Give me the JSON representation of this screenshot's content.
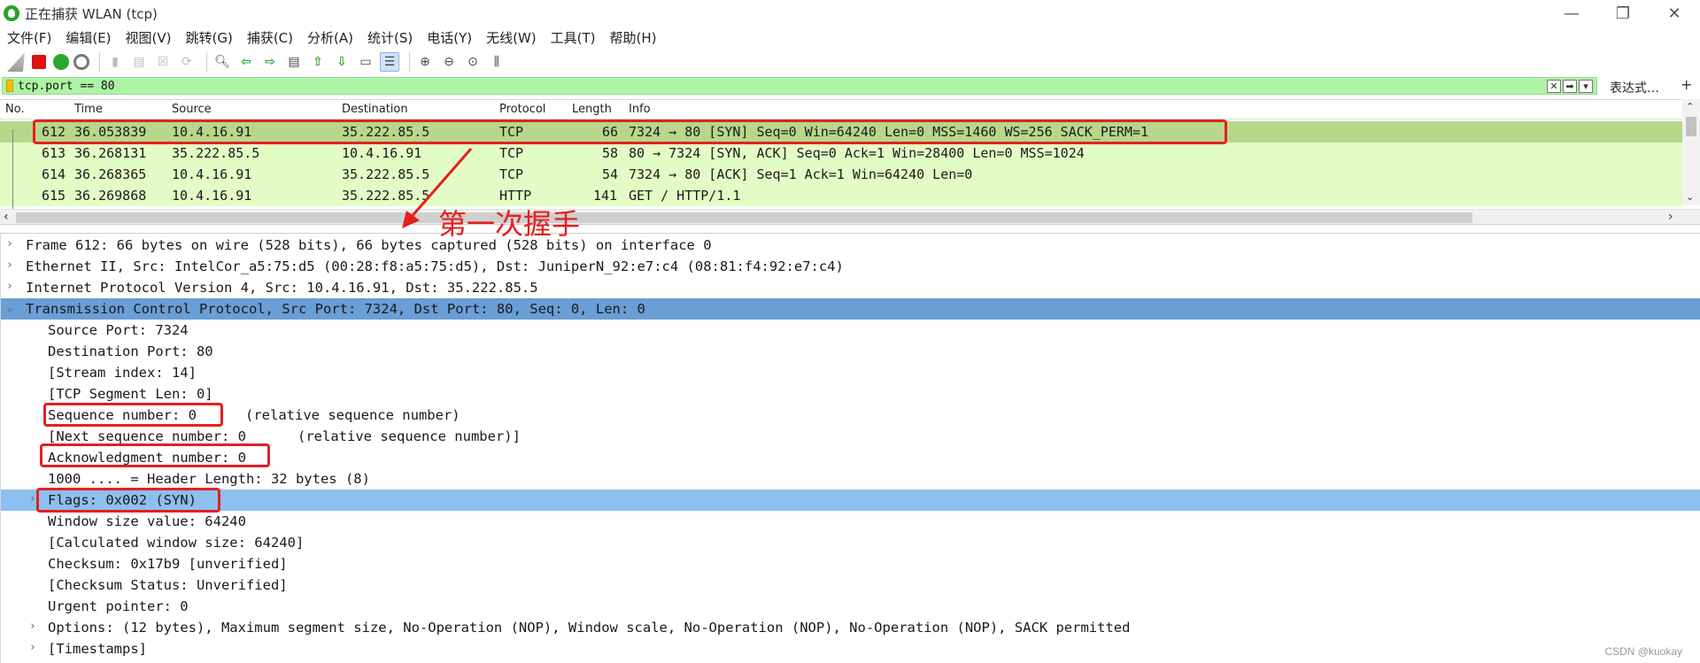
{
  "window": {
    "title": "正在捕获 WLAN (tcp)",
    "controls": [
      "—",
      "❐",
      "✕"
    ]
  },
  "menu": [
    "文件(F)",
    "编辑(E)",
    "视图(V)",
    "跳转(G)",
    "捕获(C)",
    "分析(A)",
    "统计(S)",
    "电话(Y)",
    "无线(W)",
    "工具(T)",
    "帮助(H)"
  ],
  "toolbar": {
    "icons": [
      "shark-fin-icon",
      "stop-capture-icon",
      "restart-capture-icon",
      "capture-options-icon",
      "open-file-icon",
      "save-file-icon",
      "close-file-icon",
      "reload-icon",
      "find-icon",
      "go-back-icon",
      "go-forward-icon",
      "go-to-packet-icon",
      "first-packet-icon",
      "last-packet-icon",
      "auto-scroll-icon",
      "colorize-icon",
      "zoom-in-icon",
      "zoom-out-icon",
      "normal-size-icon",
      "resize-columns-icon"
    ]
  },
  "filter": {
    "value": "tcp.port == 80",
    "expression_label": "表达式…",
    "plus_label": "+"
  },
  "packet_list": {
    "headers": {
      "no": "No.",
      "time": "Time",
      "source": "Source",
      "destination": "Destination",
      "protocol": "Protocol",
      "length": "Length",
      "info": "Info"
    },
    "rows": [
      {
        "no": "612",
        "time": "36.053839",
        "source": "10.4.16.91",
        "destination": "35.222.85.5",
        "protocol": "TCP",
        "length": "66",
        "info": "7324 → 80 [SYN] Seq=0 Win=64240 Len=0 MSS=1460 WS=256 SACK_PERM=1"
      },
      {
        "no": "613",
        "time": "36.268131",
        "source": "35.222.85.5",
        "destination": "10.4.16.91",
        "protocol": "TCP",
        "length": "58",
        "info": "80 → 7324 [SYN, ACK] Seq=0 Ack=1 Win=28400 Len=0 MSS=1024"
      },
      {
        "no": "614",
        "time": "36.268365",
        "source": "10.4.16.91",
        "destination": "35.222.85.5",
        "protocol": "TCP",
        "length": "54",
        "info": "7324 → 80 [ACK] Seq=1 Ack=1 Win=64240 Len=0"
      },
      {
        "no": "615",
        "time": "36.269868",
        "source": "10.4.16.91",
        "destination": "35.222.85.5",
        "protocol": "HTTP",
        "length": "141",
        "info": "GET / HTTP/1.1"
      }
    ]
  },
  "details": {
    "frame": "Frame 612: 66 bytes on wire (528 bits), 66 bytes captured (528 bits) on interface 0",
    "ethernet": "Ethernet II, Src: IntelCor_a5:75:d5 (00:28:f8:a5:75:d5), Dst: JuniperN_92:e7:c4 (08:81:f4:92:e7:c4)",
    "ip": "Internet Protocol Version 4, Src: 10.4.16.91, Dst: 35.222.85.5",
    "tcp": "Transmission Control Protocol, Src Port: 7324, Dst Port: 80, Seq: 0, Len: 0",
    "tcp_fields": {
      "src_port": "Source Port: 7324",
      "dst_port": "Destination Port: 80",
      "stream_index": "[Stream index: 14]",
      "segment_len": "[TCP Segment Len: 0]",
      "seq": "Sequence number: 0",
      "seq_note": "(relative sequence number)",
      "next_seq": "[Next sequence number: 0",
      "next_seq_note": "(relative sequence number)]",
      "ack": "Acknowledgment number: 0",
      "header_len": "1000 .... = Header Length: 32 bytes (8)",
      "flags": "Flags: 0x002 (SYN)",
      "window": "Window size value: 64240",
      "calc_window": "[Calculated window size: 64240]",
      "checksum": "Checksum: 0x17b9 [unverified]",
      "checksum_status": "[Checksum Status: Unverified]",
      "urgent": "Urgent pointer: 0",
      "options": "Options: (12 bytes), Maximum segment size, No-Operation (NOP), Window scale, No-Operation (NOP), No-Operation (NOP), SACK permitted",
      "timestamps": "[Timestamps]"
    }
  },
  "annotation": {
    "label": "第一次握手",
    "color": "#e61f1f"
  },
  "watermark": "CSDN @kuokay",
  "colors": {
    "filter_bg": "#aef4a5",
    "selected_packet": "#b7d88a",
    "tcp_packet": "#e3fcc5",
    "selected_detail": "#6a9ed6",
    "highlight_detail": "#8dbff0"
  }
}
